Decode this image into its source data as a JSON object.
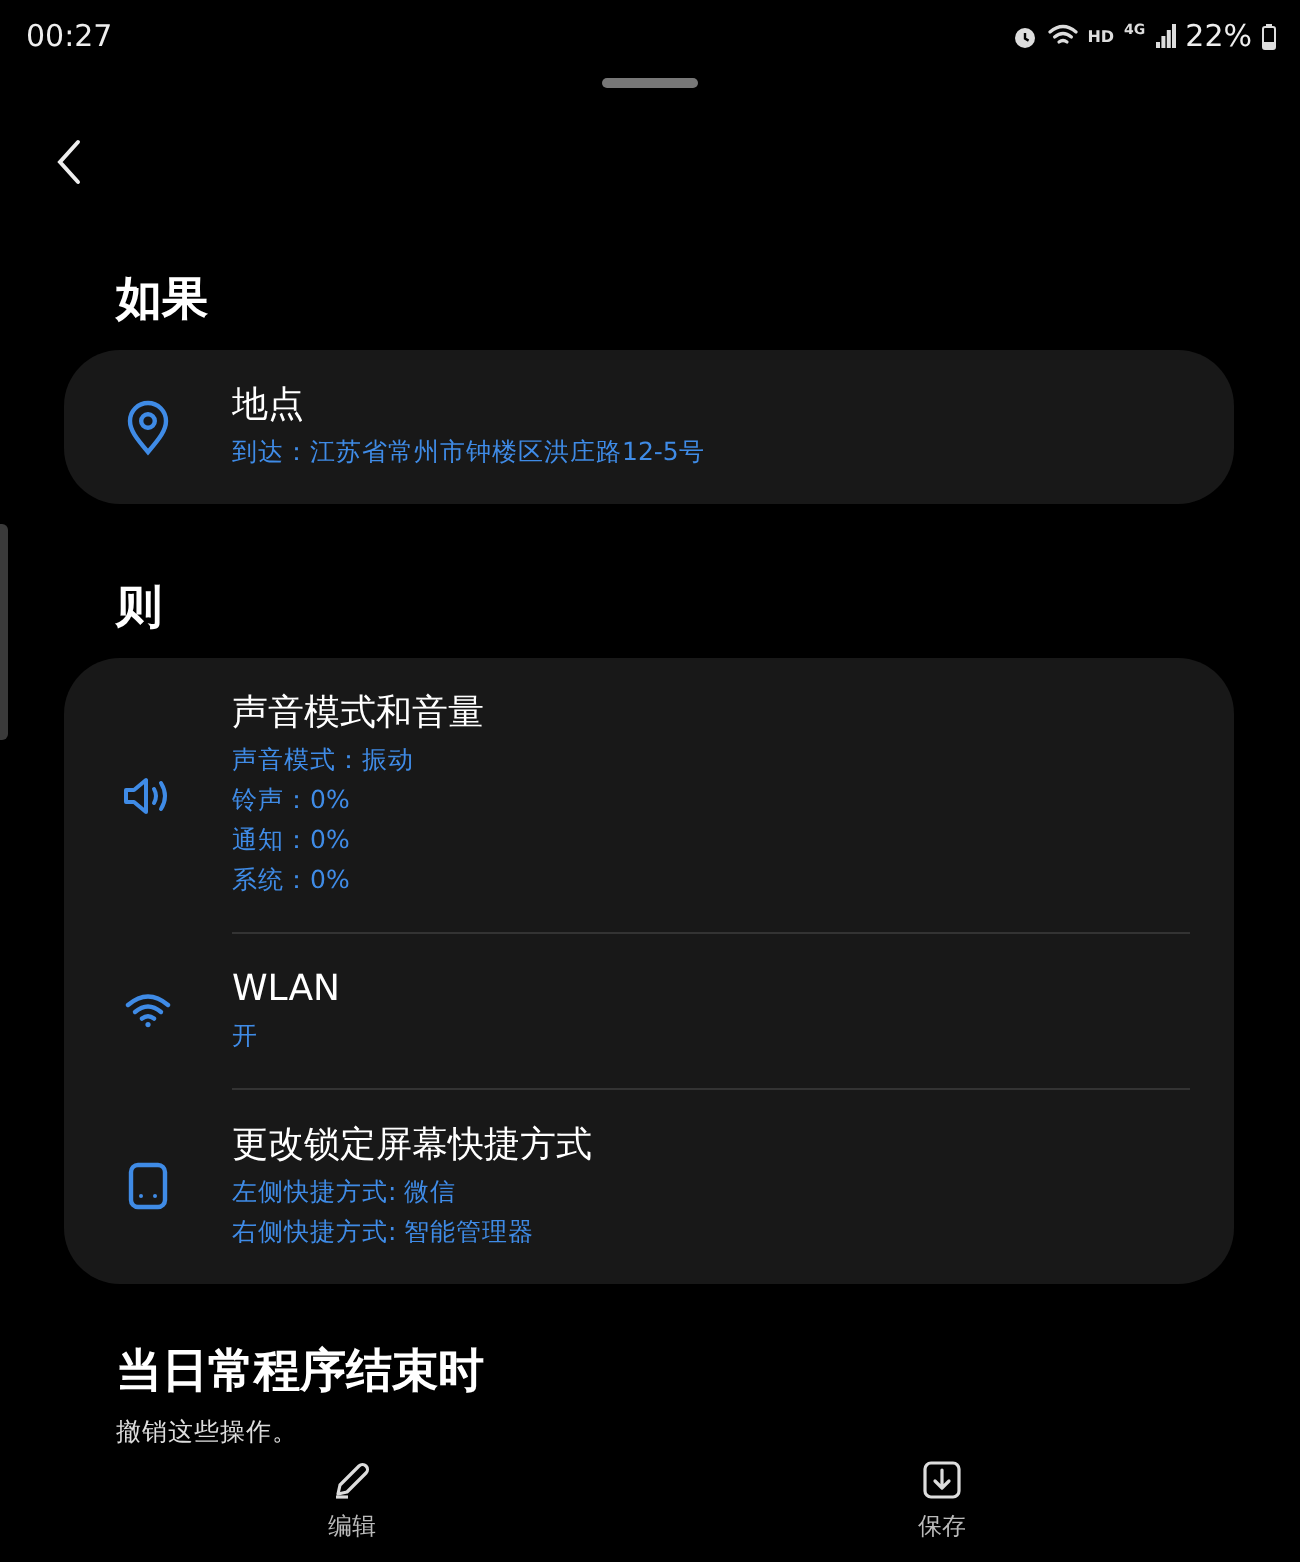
{
  "status_bar": {
    "time": "00:27",
    "hd_label": "HD",
    "network_label": "4G",
    "battery": "22%"
  },
  "sections": [
    {
      "heading": "如果",
      "items": [
        {
          "kind": "location",
          "title": "地点",
          "details": [
            "到达：江苏省常州市钟楼区洪庄路12-5号"
          ]
        }
      ]
    },
    {
      "heading": "则",
      "items": [
        {
          "kind": "sound",
          "title": "声音模式和音量",
          "details": [
            "声音模式：振动",
            "铃声：0%",
            "通知：0%",
            "系统：0%"
          ]
        },
        {
          "kind": "wifi",
          "title": "WLAN",
          "details": [
            "开"
          ]
        },
        {
          "kind": "lockscreen",
          "title": "更改锁定屏幕快捷方式",
          "details": [
            "左侧快捷方式: 微信",
            "右侧快捷方式: 智能管理器"
          ]
        }
      ]
    }
  ],
  "end_section": {
    "heading": "当日常程序结束时",
    "description": "撤销这些操作。"
  },
  "bottom_bar": [
    {
      "kind": "edit",
      "label": "编辑"
    },
    {
      "kind": "save",
      "label": "保存"
    }
  ]
}
